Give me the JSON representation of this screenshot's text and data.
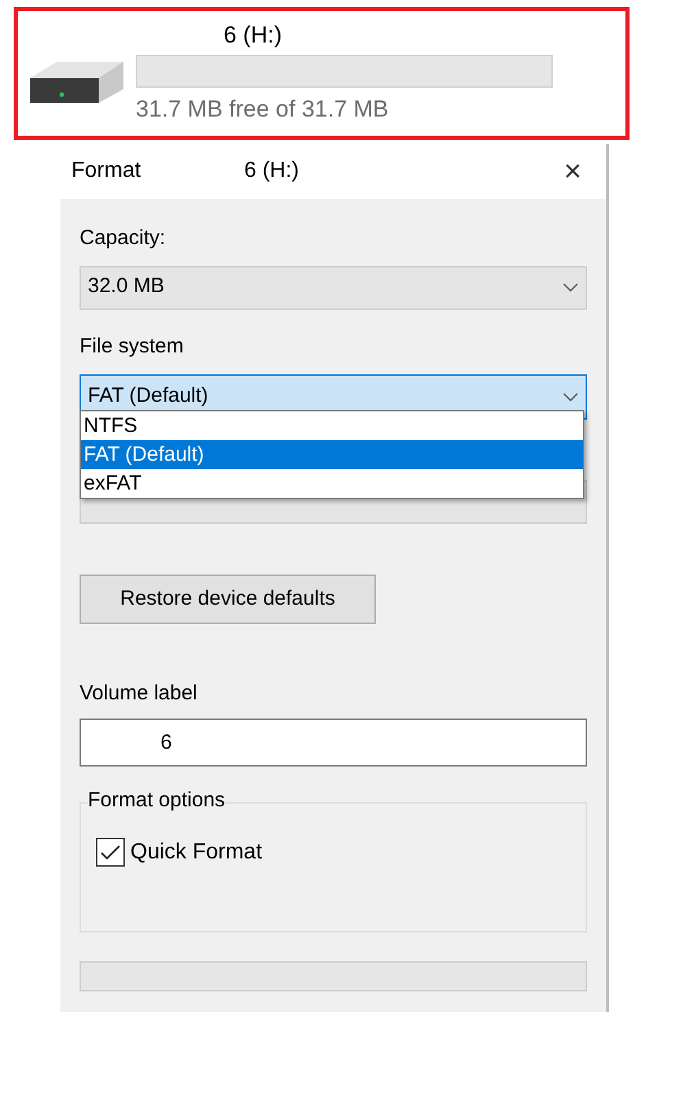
{
  "drive": {
    "title": "6 (H:)",
    "usage": {
      "level": 0
    },
    "free_text": "31.7 MB free of 31.7 MB"
  },
  "dialog": {
    "title": "Format",
    "drive": "6 (H:)",
    "close": "×",
    "capacity": {
      "label": "Capacity:",
      "value": "32.0 MB"
    },
    "file_system": {
      "label": "File system",
      "value": "FAT (Default)",
      "expanded": true,
      "options": [
        {
          "label": "NTFS",
          "selected": false
        },
        {
          "label": "FAT (Default)",
          "selected": true
        },
        {
          "label": "exFAT",
          "selected": false
        }
      ]
    },
    "restore_button": "Restore device defaults",
    "volume_label": {
      "label": "Volume label",
      "value": "6"
    },
    "format_options": {
      "label": "Format options",
      "items": [
        {
          "label": "Quick Format",
          "checked": true
        }
      ]
    },
    "progress": {
      "level": 0
    }
  }
}
